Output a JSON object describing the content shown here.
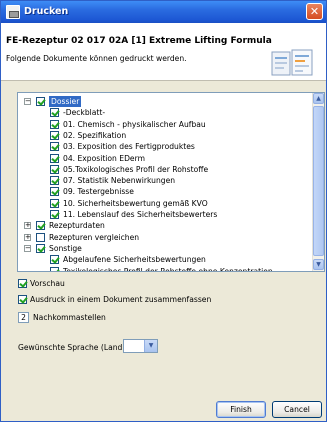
{
  "window": {
    "title": "Drucken",
    "close_glyph": "✕"
  },
  "header": {
    "title": "FE-Rezeptur 02 017 02A [1] Extreme Lifting Formula",
    "description": "Folgende Dokumente können gedruckt werden."
  },
  "tree": {
    "items": [
      {
        "label": "Dossier",
        "checked": true,
        "expanded": true,
        "level": 0,
        "selected": true
      },
      {
        "label": "-Deckblatt-",
        "checked": true,
        "level": 1
      },
      {
        "label": "01. Chemisch - physikalischer Aufbau",
        "checked": true,
        "level": 1
      },
      {
        "label": "02. Spezifikation",
        "checked": true,
        "level": 1
      },
      {
        "label": "03. Exposition des Fertigproduktes",
        "checked": true,
        "level": 1
      },
      {
        "label": "04. Exposition EDerm",
        "checked": true,
        "level": 1
      },
      {
        "label": "05.Toxikologisches Profil der Rohstoffe",
        "checked": true,
        "level": 1
      },
      {
        "label": "07. Statistik Nebenwirkungen",
        "checked": true,
        "level": 1
      },
      {
        "label": "09. Testergebnisse",
        "checked": true,
        "level": 1
      },
      {
        "label": "10. Sicherheitsbewertung gemäß KVO",
        "checked": true,
        "level": 1
      },
      {
        "label": "11. Lebenslauf des Sicherheitsbewerters",
        "checked": true,
        "level": 1
      },
      {
        "label": "Rezepturdaten",
        "checked": true,
        "expanded": false,
        "level": 0
      },
      {
        "label": "Rezepturen vergleichen",
        "checked": false,
        "expanded": false,
        "level": 0
      },
      {
        "label": "Sonstige",
        "checked": true,
        "expanded": true,
        "level": 0
      },
      {
        "label": "Abgelaufene Sicherheitsbewertungen",
        "checked": true,
        "level": 1
      },
      {
        "label": "Toxikologisches Profil der Rohstoffe ohne Konzentration",
        "checked": true,
        "level": 1
      }
    ]
  },
  "options": {
    "preview_label": "Vorschau",
    "preview_checked": true,
    "combine_label": "Ausdruck in einem Dokument zusammenfassen",
    "combine_checked": true,
    "decimals_value": "2",
    "decimals_label": "Nachkommastellen",
    "language_label": "Gewünschte Sprache (Land)",
    "language_value": ""
  },
  "buttons": {
    "finish": "Finish",
    "cancel": "Cancel"
  }
}
